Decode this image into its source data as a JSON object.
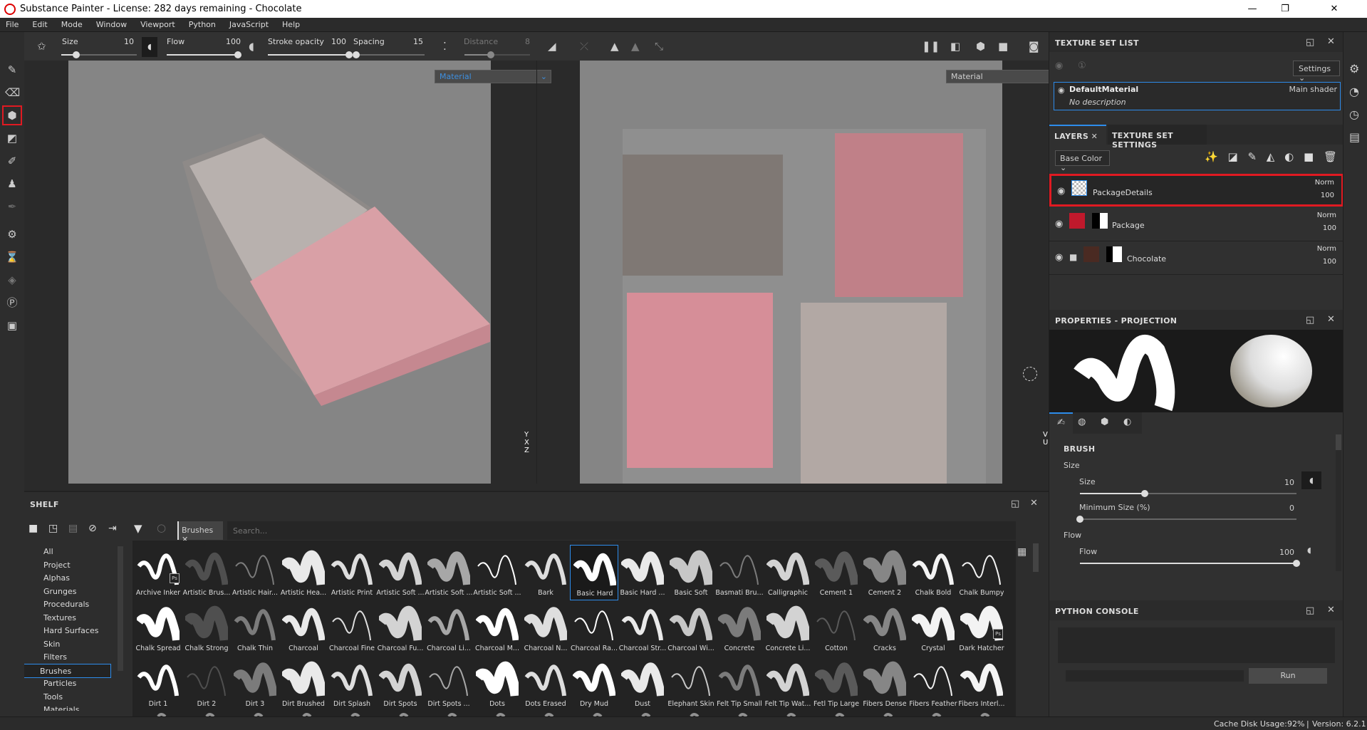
{
  "window": {
    "title": "Substance Painter - License: 282 days remaining - Chocolate",
    "minimize": "—",
    "maximize": "❐",
    "close": "✕"
  },
  "menu": [
    "File",
    "Edit",
    "Mode",
    "Window",
    "Viewport",
    "Python",
    "JavaScript",
    "Help"
  ],
  "toolbar": {
    "size_label": "Size",
    "size_value": "10",
    "size_fraction": 0.2,
    "flow_label": "Flow",
    "flow_value": "100",
    "flow_fraction": 1.0,
    "stroke_opacity_label": "Stroke opacity",
    "stroke_opacity_value": "100",
    "stroke_opacity_fraction": 1.0,
    "spacing_label": "Spacing",
    "spacing_value": "15",
    "spacing_fraction": 0.0,
    "distance_label": "Distance",
    "distance_value": "8",
    "distance_fraction": 0.4
  },
  "viewports": {
    "left_mode": "Material",
    "right_mode": "Material",
    "left_axes": {
      "y": "Y",
      "x": "X",
      "z": "Z"
    },
    "right_axes": {
      "v": "V",
      "u": "U"
    }
  },
  "texture_set_list": {
    "title": "TEXTURE SET LIST",
    "settings_label": "Settings",
    "material_name": "DefaultMaterial",
    "material_shader": "Main shader",
    "material_description": "No description"
  },
  "layers": {
    "tab_label": "LAYERS",
    "other_tab_label": "TEXTURE SET SETTINGS",
    "channel": "Base Color",
    "items": [
      {
        "name": "PackageDetails",
        "blend": "Norm",
        "opacity": "100",
        "selected": true
      },
      {
        "name": "Package",
        "blend": "Norm",
        "opacity": "100",
        "color": "#c0192c"
      },
      {
        "name": "Chocolate",
        "blend": "Norm",
        "opacity": "100",
        "color": "#4a2a22"
      }
    ]
  },
  "properties": {
    "title": "PROPERTIES - PROJECTION",
    "section": "BRUSH",
    "size_group": "Size",
    "size_label": "Size",
    "size_value": "10",
    "size_fraction": 0.3,
    "min_size_label": "Minimum Size (%)",
    "min_size_value": "0",
    "min_size_fraction": 0.0,
    "flow_group": "Flow",
    "flow_label": "Flow",
    "flow_value": "100",
    "flow_fraction": 1.0
  },
  "python_console": {
    "title": "PYTHON CONSOLE",
    "run_label": "Run"
  },
  "shelf": {
    "title": "SHELF",
    "filter_tag": "Brushes",
    "search_placeholder": "Search...",
    "categories": [
      "All",
      "Project",
      "Alphas",
      "Grunges",
      "Procedurals",
      "Textures",
      "Hard Surfaces",
      "Skin",
      "Filters",
      "Brushes",
      "Particles",
      "Tools",
      "Materials"
    ],
    "selected_category": "Brushes",
    "brushes": [
      "Archive Inker",
      "Artistic Brus...",
      "Artistic Hair...",
      "Artistic Hea...",
      "Artistic Print",
      "Artistic Soft ...",
      "Artistic Soft ...",
      "Artistic Soft ...",
      "Bark",
      "Basic Hard",
      "Basic Hard ...",
      "Basic Soft",
      "Basmati Bru...",
      "Calligraphic",
      "Cement 1",
      "Cement 2",
      "Chalk Bold",
      "Chalk Bumpy",
      "Chalk Spread",
      "Chalk Strong",
      "Chalk Thin",
      "Charcoal",
      "Charcoal Fine",
      "Charcoal Fu...",
      "Charcoal Li...",
      "Charcoal M...",
      "Charcoal N...",
      "Charcoal Ra...",
      "Charcoal Str...",
      "Charcoal Wi...",
      "Concrete",
      "Concrete Li...",
      "Cotton",
      "Cracks",
      "Crystal",
      "Dark Hatcher",
      "Dirt 1",
      "Dirt 2",
      "Dirt 3",
      "Dirt Brushed",
      "Dirt Splash",
      "Dirt Spots",
      "Dirt Spots ...",
      "Dots",
      "Dots Erased",
      "Dry Mud",
      "Dust",
      "Elephant Skin",
      "Felt Tip Small",
      "Felt Tip Wat...",
      "Fetl Tip Large",
      "Fibers Dense",
      "Fibers Feather",
      "Fibers Interl..."
    ],
    "selected_brush": "Basic Hard",
    "ps_badges": [
      "Archive Inker",
      "Dark Hatcher"
    ]
  },
  "status": {
    "cache_label": "Cache Disk Usage:",
    "cache_value": "92%",
    "version": "Version: 6.2.1"
  },
  "colors": {
    "accent": "#2d8ceb",
    "highlight": "#e01a22",
    "package": "#e9a0a8"
  }
}
